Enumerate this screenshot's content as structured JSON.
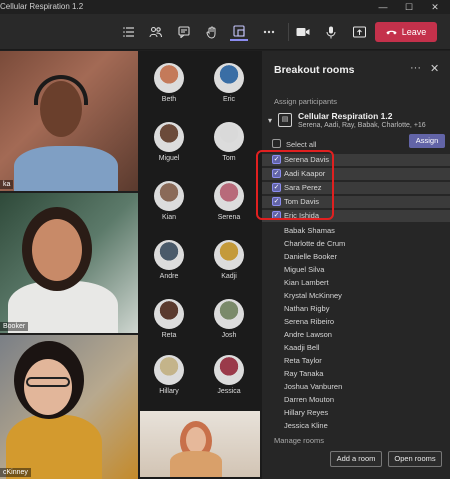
{
  "window": {
    "title": "Cellular Respiration 1.2",
    "controls": {
      "minimize": "—",
      "maximize": "☐",
      "close": "✕"
    }
  },
  "toolbar": {
    "icons": [
      "list-icon",
      "people-icon",
      "chat-icon",
      "raise-hand-icon",
      "breakout-rooms-icon",
      "more-icon",
      "camera-icon",
      "mic-icon",
      "share-icon"
    ],
    "leave_label": "Leave",
    "leave_color": "#c4314b"
  },
  "videos": {
    "tile1_label": "ka",
    "tile2_label": "Booker",
    "tile3_label": "cKinney"
  },
  "gallery": {
    "people": [
      {
        "name": "Beth",
        "color": "#c47a5a"
      },
      {
        "name": "Eric",
        "color": "#3a6ea5"
      },
      {
        "name": "Miguel",
        "color": "#6b4a3a"
      },
      {
        "name": "Tom",
        "color": "#d9d9d9"
      },
      {
        "name": "Kian",
        "color": "#8a6a58"
      },
      {
        "name": "Serena",
        "color": "#b86a7a"
      },
      {
        "name": "Andre",
        "color": "#4a5a6a"
      },
      {
        "name": "Kadji",
        "color": "#c49a3a"
      },
      {
        "name": "Reta",
        "color": "#5a3a2e"
      },
      {
        "name": "Josh",
        "color": "#7a8a6a"
      },
      {
        "name": "Hillary",
        "color": "#c4b48a"
      },
      {
        "name": "Jessica",
        "color": "#9a3a4a"
      }
    ]
  },
  "breakout": {
    "title": "Breakout rooms",
    "assign_label": "Assign participants",
    "room_name": "Cellular Respiration 1.2",
    "room_members": "Serena, Aadi, Ray, Babak, Charlotte, +16",
    "select_all": "Select all",
    "assign_button": "Assign",
    "selected": [
      "Serena Davis",
      "Aadi Kaapor",
      "Sara Perez",
      "Tom Davis",
      "Eric Ishida"
    ],
    "unselected": [
      "Babak Shamas",
      "Charlotte de Crum",
      "Danielle Booker",
      "Miguel Silva",
      "Kian Lambert",
      "Krystal McKinney",
      "Nathan Rigby",
      "Serena Ribeiro",
      "Andre Lawson",
      "Kaadji Bell",
      "Reta Taylor",
      "Ray Tanaka",
      "Joshua Vanburen",
      "Darren Mouton",
      "Hillary Reyes",
      "Jessica Kline"
    ],
    "manage_label": "Manage rooms",
    "add_room": "Add a room",
    "open_rooms": "Open rooms",
    "accent": "#6264a7",
    "highlight_color": "#e02020"
  }
}
